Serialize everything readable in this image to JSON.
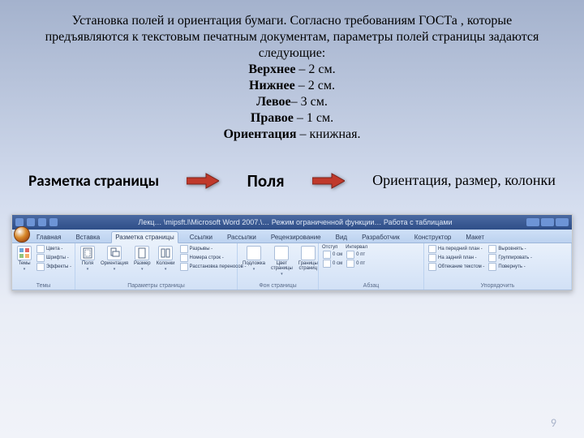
{
  "body": {
    "p1": "Установка полей и ориентация бумаги. Согласно требованиям ГОСТа , которые предъявляются к текстовым печатным документам, параметры полей страницы задаются следующие:",
    "top_label": "Верхнее",
    "top_val": " – 2 см.",
    "bottom_label": "Нижнее",
    "bottom_val": " – 2 см.",
    "left_label": "Левое",
    "left_val": "– 3 см.",
    "right_label": "Правое",
    "right_val": " – 1 см.",
    "orient_label": "Ориентация",
    "orient_val": " – книжная."
  },
  "flow": {
    "step1": "Разметка страницы",
    "step2": "Поля",
    "step3": "Ориентация, размер, колонки"
  },
  "window": {
    "title": "Лекц… \\mipsft.l\\Microsoft Word 2007.\\… Режим ограниченной функции…   Работа с таблицами"
  },
  "tabs": {
    "t1": "Главная",
    "t2": "Вставка",
    "t3": "Разметка страницы",
    "t4": "Ссылки",
    "t5": "Рассылки",
    "t6": "Рецензирование",
    "t7": "Вид",
    "t8": "Разработчик",
    "t9": "Конструктор",
    "t10": "Макет"
  },
  "ribbon": {
    "g1": {
      "name": "Темы",
      "themes": "Темы",
      "colors": "Цвета -",
      "fonts": "Шрифты -",
      "effects": "Эффекты -"
    },
    "g2": {
      "name": "Параметры страницы",
      "fields": "Поля",
      "orient": "Ориентация",
      "size": "Размер",
      "columns": "Колонки",
      "breaks": "Разрывы -",
      "linenums": "Номера строк -",
      "hyphen": "Расстановка переносов -"
    },
    "g3": {
      "name": "Фон страницы",
      "watermark": "Подложка",
      "color": "Цвет страницы",
      "borders": "Границы страниц"
    },
    "g4": {
      "name": "Абзац",
      "indent": "Отступ",
      "left": "0 см",
      "right": "0 см",
      "spacing": "Интервал",
      "before": "0 пт",
      "after": "0 пт"
    },
    "g5": {
      "name": "Упорядочить",
      "front": "На передний план -",
      "back": "На задний план -",
      "textwrap": "Обтекание текстом -",
      "align": "Выровнять -",
      "group": "Группировать -",
      "rotate": "Повернуть -"
    }
  },
  "page_number": "9"
}
